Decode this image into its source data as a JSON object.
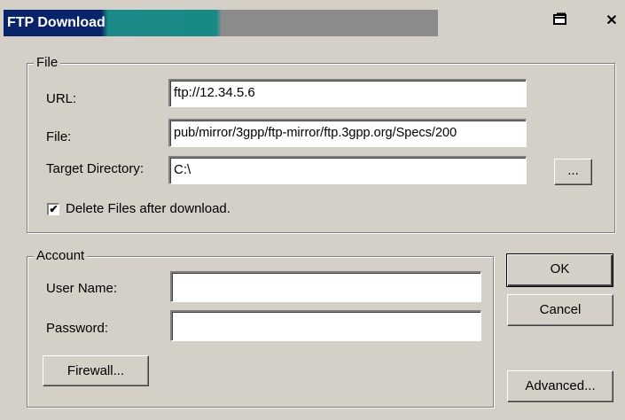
{
  "window": {
    "title": "FTP Download",
    "minimize_icon": "window-restore-icon",
    "close_icon": "close-x-icon"
  },
  "file_group": {
    "label": "File",
    "url_label": "URL:",
    "url_value": "ftp://12.34.5.6",
    "file_label": "File:",
    "file_value": "pub/mirror/3gpp/ftp-mirror/ftp.3gpp.org/Specs/200",
    "target_label": "Target Directory:",
    "target_value": "C:\\",
    "browse_label": "...",
    "delete_checkbox_checked": true,
    "delete_label": "Delete Files after download."
  },
  "account_group": {
    "label": "Account",
    "username_label": "User Name:",
    "username_value": "",
    "password_label": "Password:",
    "password_value": "",
    "firewall_label": "Firewall..."
  },
  "buttons": {
    "ok": "OK",
    "cancel": "Cancel",
    "advanced": "Advanced..."
  },
  "colors": {
    "title_active": "#0a246a",
    "title_teal": "#1c8a88",
    "title_inactive": "#8b8b8b",
    "face": "#d4d0c8"
  }
}
